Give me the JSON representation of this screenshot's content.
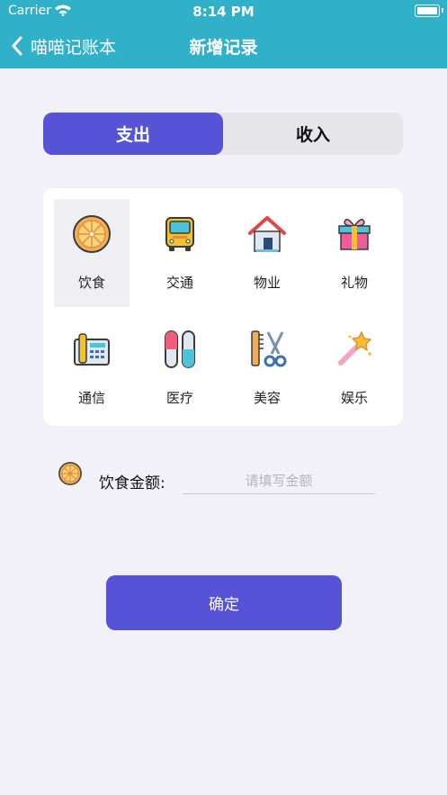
{
  "status_bar": {
    "carrier": "Carrier",
    "time": "8:14 PM"
  },
  "nav": {
    "back_label": "喵喵记账本",
    "title": "新增记录"
  },
  "segment": {
    "expense": "支出",
    "income": "收入",
    "selected": "expense"
  },
  "categories": [
    {
      "label": "饮食",
      "icon": "orange-slice-icon",
      "selected": true
    },
    {
      "label": "交通",
      "icon": "bus-icon"
    },
    {
      "label": "物业",
      "icon": "house-icon"
    },
    {
      "label": "礼物",
      "icon": "gift-icon"
    },
    {
      "label": "通信",
      "icon": "telephone-icon"
    },
    {
      "label": "医疗",
      "icon": "pills-icon"
    },
    {
      "label": "美容",
      "icon": "comb-scissors-icon"
    },
    {
      "label": "娱乐",
      "icon": "magic-wand-icon"
    }
  ],
  "amount": {
    "label": "饮食金额:",
    "placeholder": "请填写金额",
    "value": ""
  },
  "confirm_label": "确定",
  "colors": {
    "header": "#31b1c9",
    "accent": "#5753d6",
    "background": "#f2f1f7"
  }
}
